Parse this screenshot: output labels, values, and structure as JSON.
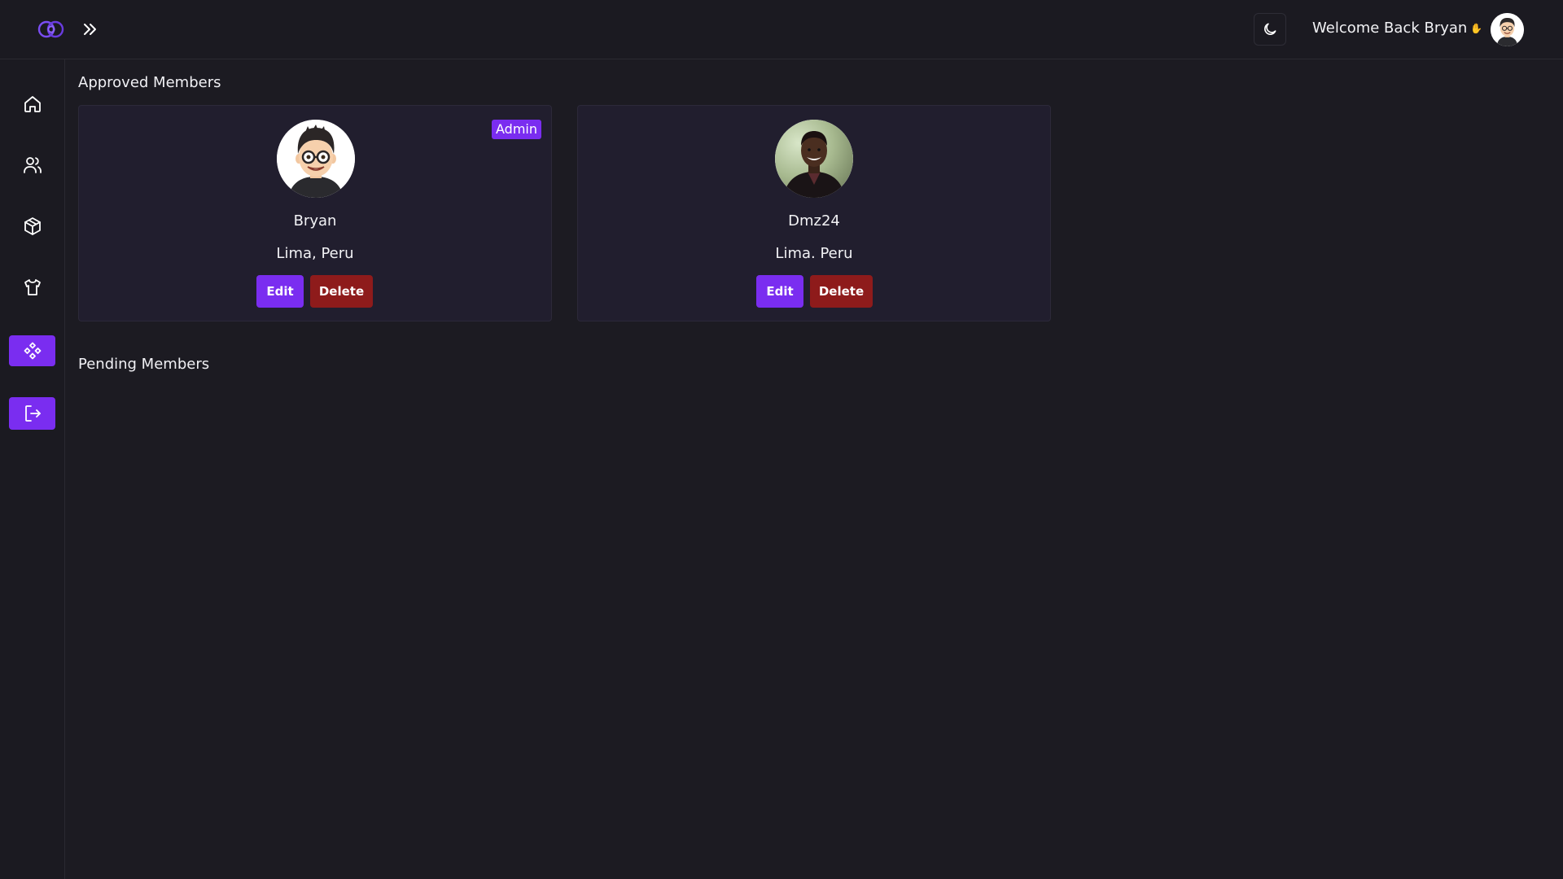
{
  "header": {
    "welcome_text": "Welcome Back Bryan",
    "welcome_emoji": "✋",
    "logo_icon": "infinity-logo-icon",
    "expand_icon": "chevrons-right-icon",
    "theme_icon": "moon-icon"
  },
  "sidebar": {
    "items": [
      {
        "name": "home",
        "icon": "home-icon",
        "active": false
      },
      {
        "name": "users",
        "icon": "users-icon",
        "active": false
      },
      {
        "name": "packages",
        "icon": "box-icon",
        "active": false
      },
      {
        "name": "apparel",
        "icon": "shirt-icon",
        "active": false
      },
      {
        "name": "components",
        "icon": "diamonds-icon",
        "active": true
      },
      {
        "name": "logout",
        "icon": "logout-icon",
        "active": true
      }
    ]
  },
  "approved": {
    "title": "Approved Members",
    "members": [
      {
        "name": "Bryan",
        "location": "Lima, Peru",
        "badge": "Admin",
        "edit_label": "Edit",
        "delete_label": "Delete"
      },
      {
        "name": "Dmz24",
        "location": "Lima. Peru",
        "badge": "",
        "edit_label": "Edit",
        "delete_label": "Delete"
      }
    ]
  },
  "pending": {
    "title": "Pending Members"
  },
  "colors": {
    "accent": "#7a2df0",
    "danger": "#8e1b1b",
    "background": "#1c1b22",
    "card": "#211e2e"
  }
}
